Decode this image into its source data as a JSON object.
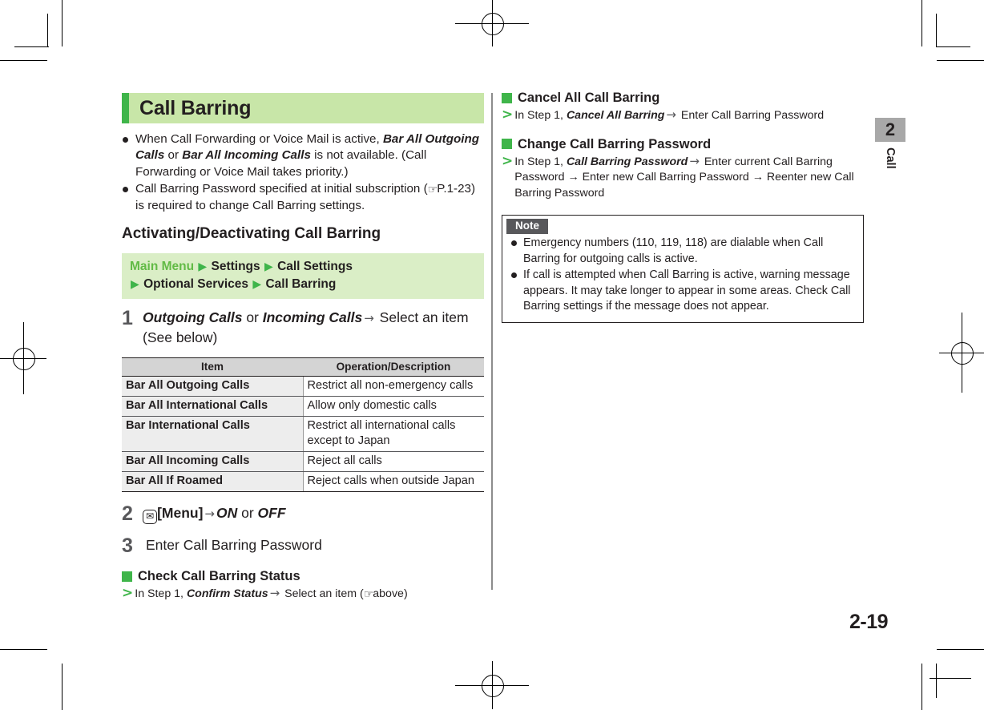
{
  "page": {
    "number": "2-19",
    "chapter_tab": {
      "number": "2",
      "label": "Call"
    }
  },
  "left_column": {
    "title": "Call Barring",
    "intro_bullets": [
      {
        "prefix": "When Call Forwarding or Voice Mail is active, ",
        "bold1": "Bar All Outgoing Calls",
        "mid": " or ",
        "bold2": "Bar All Incoming Calls",
        "suffix": " is not available. (Call Forwarding or Voice Mail takes priority.)"
      },
      {
        "prefix": "Call Barring Password specified at initial subscription (",
        "ref_icon": "reference-pointing-hand",
        "ref_text": "P.1-23",
        "suffix": ") is required to change Call Barring settings."
      }
    ],
    "section_heading": "Activating/Deactivating Call Barring",
    "menu_path": {
      "root": "Main Menu",
      "items": [
        "Settings",
        "Call Settings",
        "Optional Services",
        "Call Barring"
      ],
      "separator": "▶"
    },
    "steps": [
      {
        "number": "1",
        "bold1": "Outgoing Calls",
        "mid": " or ",
        "bold2": "Incoming Calls",
        "arrow": "→",
        "tail": " Select an item (See below)"
      },
      {
        "number": "2",
        "key_icon": "envelope-key-icon",
        "key_label": "[Menu]",
        "arrow": "→",
        "bold1": "ON",
        "mid": " or ",
        "bold2": "OFF"
      },
      {
        "number": "3",
        "text": "Enter Call Barring Password"
      }
    ],
    "table": {
      "headers": [
        "Item",
        "Operation/Description"
      ],
      "rows": [
        [
          "Bar All Outgoing Calls",
          "Restrict all non-emergency calls"
        ],
        [
          "Bar All International Calls",
          "Allow only domestic calls"
        ],
        [
          "Bar International Calls",
          "Restrict all international calls except to Japan"
        ],
        [
          "Bar All Incoming Calls",
          "Reject all calls"
        ],
        [
          "Bar All If Roamed",
          "Reject calls when outside Japan"
        ]
      ]
    },
    "subsection": {
      "heading": "Check Call Barring Status",
      "marker": ">",
      "prefix": "In Step 1, ",
      "bold": "Confirm Status",
      "arrow": "→",
      "suffix": " Select an item (",
      "ref_icon": "reference-pointing-hand",
      "ref_text": "above",
      "end": ")"
    }
  },
  "right_column": {
    "subsections": [
      {
        "heading": "Cancel All Call Barring",
        "marker": ">",
        "prefix": "In Step 1, ",
        "bold": "Cancel All Barring",
        "arrow": "→",
        "suffix": " Enter Call Barring Password"
      },
      {
        "heading": "Change Call Barring Password",
        "marker": ">",
        "prefix": "In Step 1, ",
        "bold": "Call Barring Password",
        "arrow": "→",
        "suffix": " Enter current Call Barring Password → Enter new Call Barring Password → Reenter new Call Barring Password"
      }
    ],
    "note": {
      "tag": "Note",
      "items": [
        "Emergency numbers (110, 119, 118) are dialable when Call Barring for outgoing calls is active.",
        "If call is attempted when Call Barring is active, warning message appears. It may take longer to appear in some areas. Check Call Barring settings if the message does not appear."
      ]
    }
  },
  "colors": {
    "brand_green": "#3fb54a",
    "title_bar_bg": "#c8e6a8",
    "menu_path_bg": "#daeec6",
    "table_header_bg": "#d4d4d4",
    "table_item_bg": "#ededed",
    "note_tag_bg": "#58585b",
    "chapter_tab_bg": "#a8a8a8"
  }
}
